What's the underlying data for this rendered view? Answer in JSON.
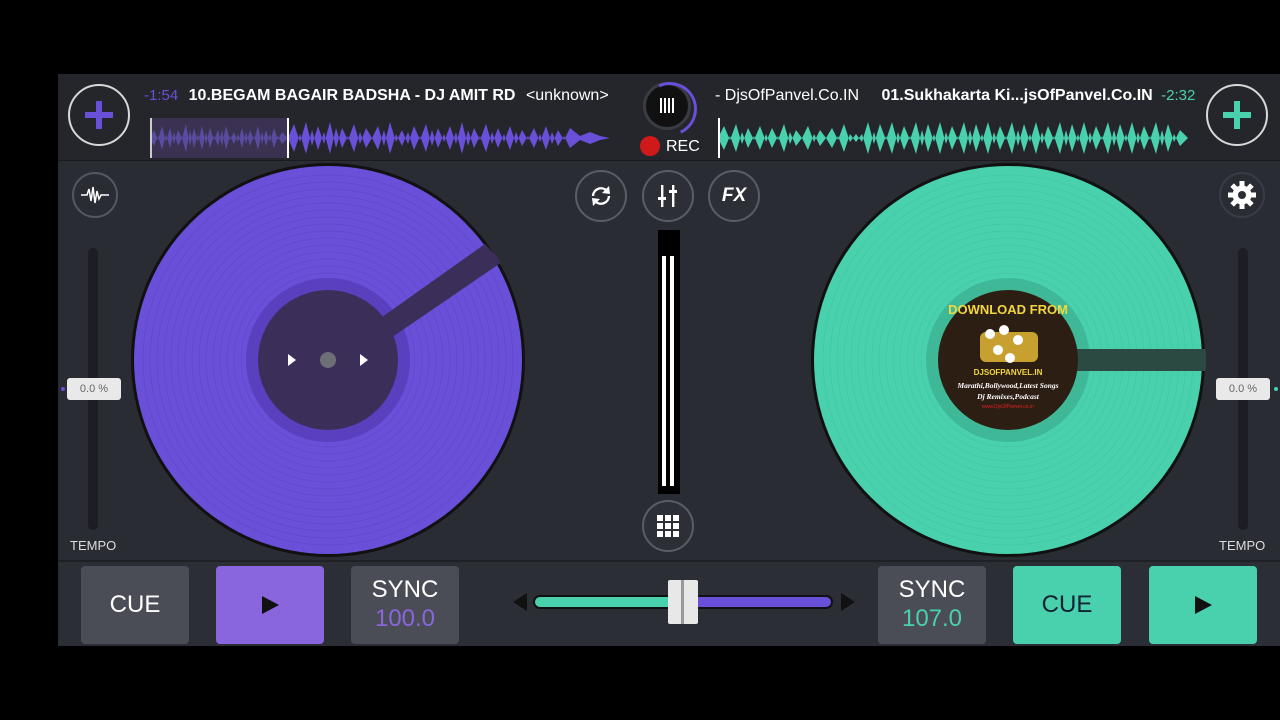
{
  "left_deck": {
    "time": "-1:54",
    "title": "10.BEGAM BAGAIR BADSHA - DJ AMIT RD",
    "artist": "<unknown>",
    "color": "#6a4fd8",
    "tempo_value": "0.0 %",
    "tempo_label": "TEMPO",
    "cue_label": "CUE",
    "sync_label": "SYNC",
    "bpm": "100.0"
  },
  "right_deck": {
    "artist": "- DjsOfPanvel.Co.IN",
    "title": "01.Sukhakarta Ki...jsOfPanvel.Co.IN",
    "time": "-2:32",
    "color": "#49d1ad",
    "tempo_value": "0.0 %",
    "tempo_label": "TEMPO",
    "cue_label": "CUE",
    "sync_label": "SYNC",
    "bpm": "107.0",
    "cover_text": {
      "line1": "DOWNLOAD FROM",
      "line2": "DJSOFPANVEL.IN",
      "line3": "Marathi,Bollywood,Latest Songs",
      "line4": "Dj Remixes,Podcast",
      "line5": "www.DjsOfPanvel.co.in"
    }
  },
  "record": {
    "label": "REC"
  },
  "center_controls": {
    "fx_label": "FX"
  },
  "icons": [
    "add-icon",
    "waveform-icon",
    "loop-icon",
    "mixer-icon",
    "fx-icon",
    "settings-icon",
    "grid-icon",
    "play-icon",
    "record-icon"
  ],
  "crossfader": {
    "position": 0.5
  }
}
